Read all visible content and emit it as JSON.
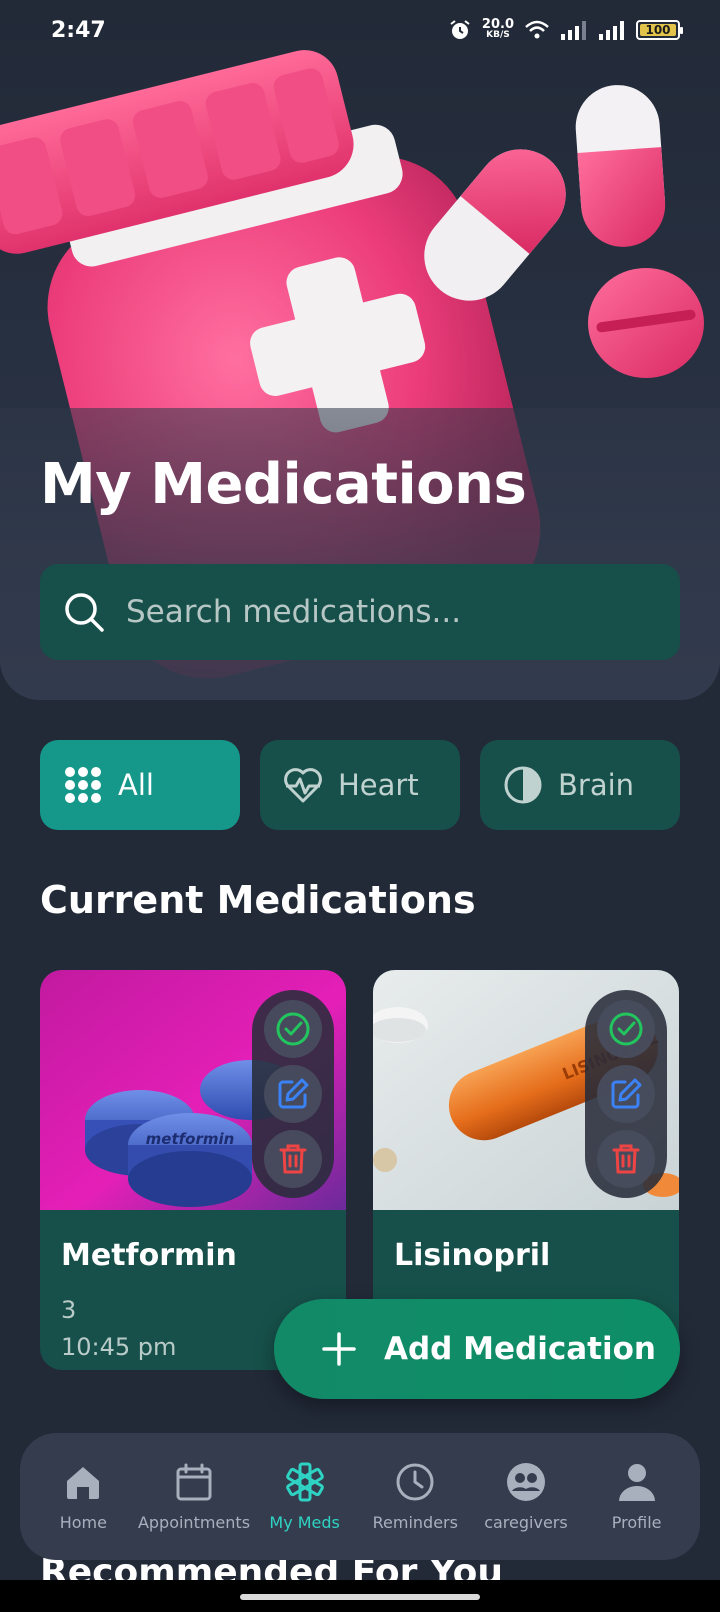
{
  "status": {
    "time": "2:47",
    "net_speed_value": "20.0",
    "net_speed_unit": "KB/S",
    "battery": "100"
  },
  "header": {
    "title": "My Medications",
    "search_placeholder": "Search medications..."
  },
  "filters": [
    {
      "label": "All",
      "icon": "grid-icon",
      "active": true
    },
    {
      "label": "Heart",
      "icon": "heartbeat-icon",
      "active": false
    },
    {
      "label": "Brain",
      "icon": "brain-icon",
      "active": false
    }
  ],
  "section": {
    "current_title": "Current Medications",
    "recommended_title": "Recommended For You"
  },
  "medications": [
    {
      "name": "Metformin",
      "dosage": "3",
      "time": "10:45 pm",
      "pill_imprint": "metformin"
    },
    {
      "name": "Lisinopril",
      "dosage": "",
      "time": "",
      "pill_imprint": "LISINOPRIL"
    }
  ],
  "fab": {
    "label": "Add Medication"
  },
  "nav": [
    {
      "label": "Home",
      "icon": "home-icon",
      "active": false
    },
    {
      "label": "Appointments",
      "icon": "calendar-icon",
      "active": false
    },
    {
      "label": "My Meds",
      "icon": "asterisk-icon",
      "active": true
    },
    {
      "label": "Reminders",
      "icon": "clock-icon",
      "active": false
    },
    {
      "label": "caregivers",
      "icon": "people-icon",
      "active": false
    },
    {
      "label": "Profile",
      "icon": "person-icon",
      "active": false
    }
  ],
  "colors": {
    "background": "#222a38",
    "card": "#17504a",
    "accent": "#15978a",
    "fab": "#0e8e66",
    "nav_active": "#2fd3c3",
    "success": "#22c55e",
    "edit": "#3b82f6",
    "delete": "#ef4444"
  }
}
